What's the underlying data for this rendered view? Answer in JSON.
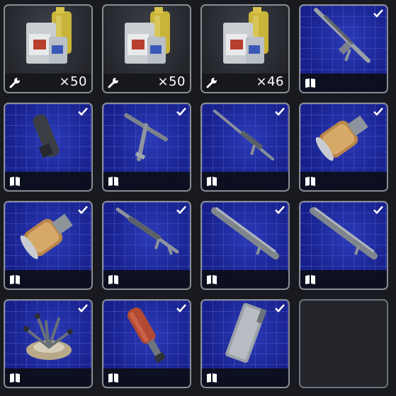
{
  "inventory": {
    "slots": [
      {
        "kind": "supply",
        "item": "oil-canisters",
        "icon": "wrench-icon",
        "quantity": "×50"
      },
      {
        "kind": "supply",
        "item": "oil-canisters",
        "icon": "wrench-icon",
        "quantity": "×50"
      },
      {
        "kind": "supply",
        "item": "oil-canisters",
        "icon": "wrench-icon",
        "quantity": "×46"
      },
      {
        "kind": "blueprint",
        "item": "rifle-scoped",
        "icon": "book-icon",
        "checked": true
      },
      {
        "kind": "blueprint",
        "item": "cylinder-part",
        "icon": "book-icon",
        "checked": true
      },
      {
        "kind": "blueprint",
        "item": "t-handle-tool",
        "icon": "book-icon",
        "checked": true
      },
      {
        "kind": "blueprint",
        "item": "long-rifle",
        "icon": "book-icon",
        "checked": true
      },
      {
        "kind": "blueprint",
        "item": "jet-engine-part",
        "icon": "book-icon",
        "checked": true
      },
      {
        "kind": "blueprint",
        "item": "jet-engine-part",
        "icon": "book-icon",
        "checked": true
      },
      {
        "kind": "blueprint",
        "item": "heavy-rifle",
        "icon": "book-icon",
        "checked": true
      },
      {
        "kind": "blueprint",
        "item": "gatling-barrel",
        "icon": "book-icon",
        "checked": true
      },
      {
        "kind": "blueprint",
        "item": "gatling-barrel",
        "icon": "book-icon",
        "checked": true
      },
      {
        "kind": "blueprint",
        "item": "pronged-device",
        "icon": "book-icon",
        "checked": true
      },
      {
        "kind": "blueprint",
        "item": "fire-extinguisher-tube",
        "icon": "book-icon",
        "checked": true
      },
      {
        "kind": "blueprint",
        "item": "armor-plate",
        "icon": "book-icon",
        "checked": true
      },
      {
        "kind": "empty"
      }
    ]
  },
  "colors": {
    "background": "#191a20",
    "slot_border": "#8a8d94",
    "blueprint_blue": "#17208a",
    "check": "#ffffff"
  }
}
